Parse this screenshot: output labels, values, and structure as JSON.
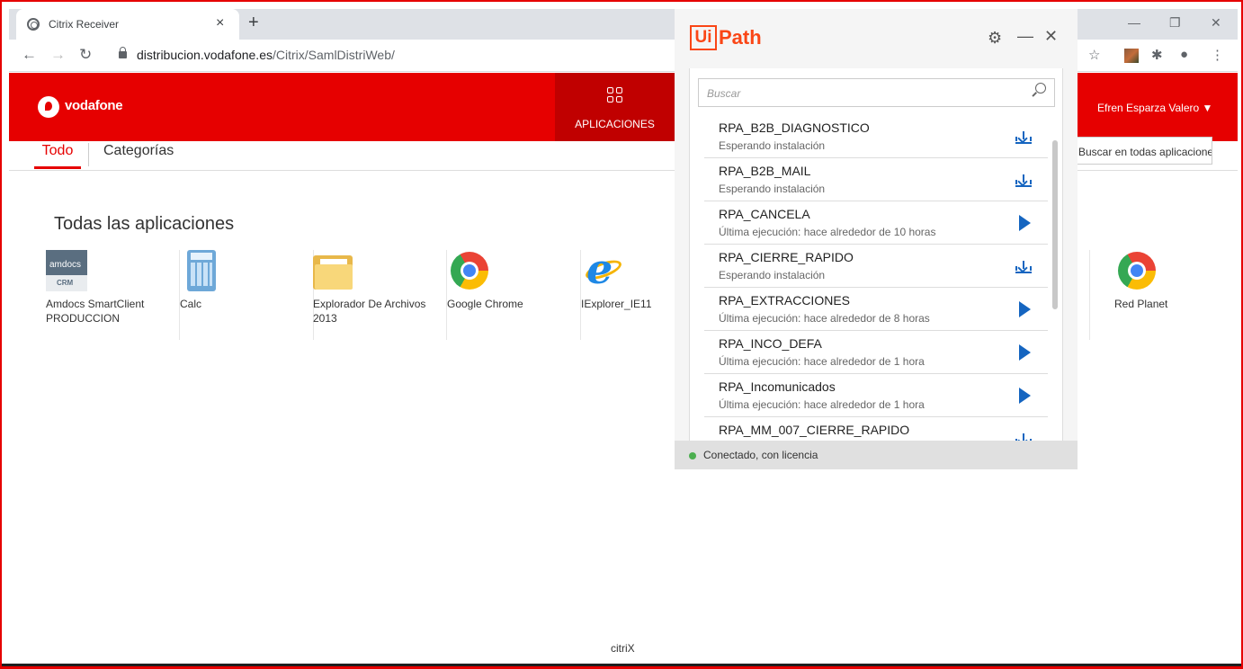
{
  "browser": {
    "tab_title": "Citrix Receiver",
    "tab_close": "×",
    "new_tab": "+",
    "url_host": "distribucion.vodafone.es",
    "url_path": "/Citrix/SamlDistriWeb/",
    "window_controls": [
      "—",
      "❐",
      "✕"
    ]
  },
  "vodafone": {
    "brand": "vodafone",
    "apps_label": "APLICACIONES",
    "user": "Efren Esparza Valero ▼",
    "search_all": "Buscar en todas aplicaciones",
    "tabs": [
      "Todo",
      "Categorías"
    ],
    "section_title": "Todas las aplicaciones",
    "apps": [
      {
        "name": "Amdocs SmartClient PRODUCCION",
        "icon": "amdocs-icon"
      },
      {
        "name": "Calc",
        "icon": "calculator-icon"
      },
      {
        "name": "Explorador De Archivos 2013",
        "icon": "folder-icon"
      },
      {
        "name": "Google Chrome",
        "icon": "chrome-icon"
      },
      {
        "name": "IExplorer_IE11",
        "icon": "ie-icon"
      },
      {
        "name": "Red Planet",
        "icon": "chrome-icon"
      }
    ],
    "amdocs_logo_top": "amdocs",
    "amdocs_logo_bottom": "CRM",
    "footer": "citriX"
  },
  "uipath": {
    "logo_ui": "Ui",
    "logo_path": "Path",
    "search_placeholder": "Buscar",
    "processes": [
      {
        "name": "RPA_B2B_DIAGNOSTICO",
        "status": "Esperando instalación",
        "action": "download"
      },
      {
        "name": "RPA_B2B_MAIL",
        "status": "Esperando instalación",
        "action": "download"
      },
      {
        "name": "RPA_CANCELA",
        "status": "Última ejecución: hace alrededor de 10 horas",
        "action": "run"
      },
      {
        "name": "RPA_CIERRE_RAPIDO",
        "status": "Esperando instalación",
        "action": "download"
      },
      {
        "name": "RPA_EXTRACCIONES",
        "status": "Última ejecución: hace alrededor de 8 horas",
        "action": "run"
      },
      {
        "name": "RPA_INCO_DEFA",
        "status": "Última ejecución: hace alrededor de 1 hora",
        "action": "run"
      },
      {
        "name": "RPA_Incomunicados",
        "status": "Última ejecución: hace alrededor de 1 hora",
        "action": "run"
      },
      {
        "name": "RPA_MM_007_CIERRE_RAPIDO",
        "status": "",
        "action": "download"
      }
    ],
    "status": "Conectado, con licencia",
    "accent": "#fa4616",
    "action_color": "#1565c0"
  }
}
